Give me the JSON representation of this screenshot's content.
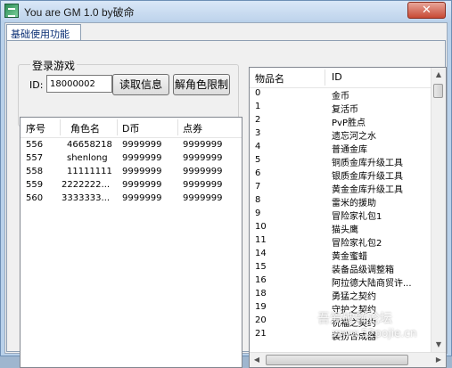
{
  "window": {
    "title": "You are GM 1.0 by破命",
    "close_glyph": "✕",
    "app_icon": "app-icon"
  },
  "tabs": [
    {
      "label": "基础使用功能",
      "active": true
    }
  ],
  "login": {
    "group_label": "登录游戏",
    "id_label": "ID:",
    "id_value": "18000002",
    "read_button": "读取信息",
    "unlock_button": "解角色限制"
  },
  "characters": {
    "columns": [
      "序号",
      "角色名",
      "D币",
      "点券"
    ],
    "rows": [
      [
        "556",
        "46658218",
        "9999999",
        "9999999"
      ],
      [
        "557",
        "shenlong",
        "9999999",
        "9999999"
      ],
      [
        "558",
        "11111111",
        "9999999",
        "9999999"
      ],
      [
        "559",
        "2222222...",
        "9999999",
        "9999999"
      ],
      [
        "560",
        "3333333...",
        "9999999",
        "9999999"
      ]
    ]
  },
  "items": {
    "columns": [
      "物品名",
      "ID"
    ],
    "rows": [
      [
        "0",
        "金币"
      ],
      [
        "1",
        "复活币"
      ],
      [
        "2",
        "PvP胜点"
      ],
      [
        "3",
        "遗忘河之水"
      ],
      [
        "4",
        "普通金库"
      ],
      [
        "5",
        "铜质金库升级工具"
      ],
      [
        "6",
        "银质金库升级工具"
      ],
      [
        "7",
        "黄金金库升级工具"
      ],
      [
        "8",
        "雷米的援助"
      ],
      [
        "9",
        "冒险家礼包1"
      ],
      [
        "10",
        "猫头鹰"
      ],
      [
        "11",
        "冒险家礼包2"
      ],
      [
        "14",
        "黄金蜜蜡"
      ],
      [
        "15",
        "装备品级调整箱"
      ],
      [
        "16",
        "阿拉德大陆商贸许..."
      ],
      [
        "18",
        "勇猛之契约"
      ],
      [
        "19",
        "守护之契约"
      ],
      [
        "20",
        "祝福之契约"
      ],
      [
        "21",
        "装扮合成器"
      ]
    ]
  },
  "watermark": {
    "line1": "吾爱破解论坛",
    "line2": "www.52pojie.cn"
  }
}
